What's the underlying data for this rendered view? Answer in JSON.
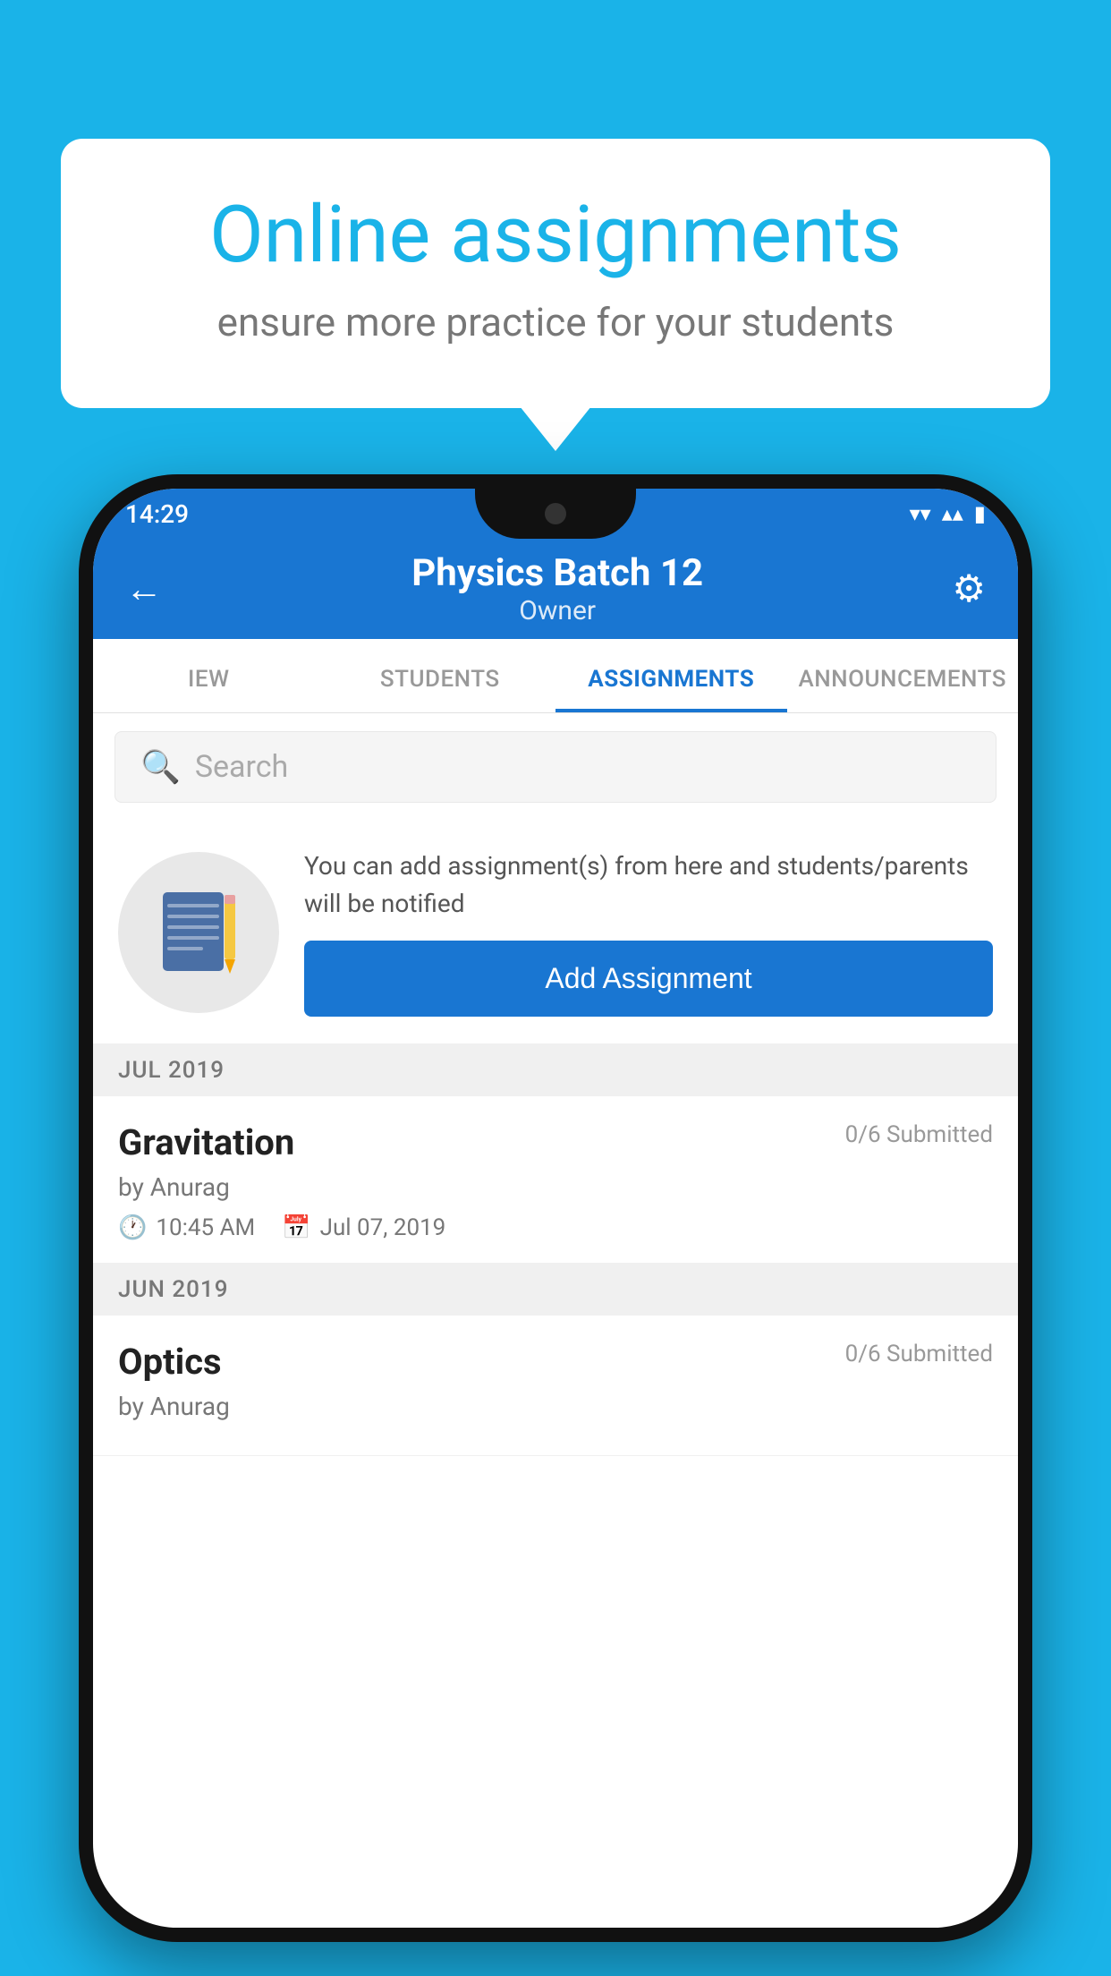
{
  "background": {
    "color": "#1ab3e8"
  },
  "speech_bubble": {
    "title": "Online assignments",
    "subtitle": "ensure more practice for your students"
  },
  "phone": {
    "status_bar": {
      "time": "14:29",
      "wifi_icon": "▼",
      "signal_icon": "▲",
      "battery_icon": "▮"
    },
    "header": {
      "title": "Physics Batch 12",
      "subtitle": "Owner",
      "back_label": "←",
      "settings_label": "⚙"
    },
    "tabs": [
      {
        "id": "view",
        "label": "IEW",
        "active": false
      },
      {
        "id": "students",
        "label": "STUDENTS",
        "active": false
      },
      {
        "id": "assignments",
        "label": "ASSIGNMENTS",
        "active": true
      },
      {
        "id": "announcements",
        "label": "ANNOUNCEMENTS",
        "active": false
      }
    ],
    "search": {
      "placeholder": "Search"
    },
    "promo": {
      "description": "You can add assignment(s) from here and students/parents will be notified",
      "button_label": "Add Assignment"
    },
    "sections": [
      {
        "id": "jul-2019",
        "label": "JUL 2019",
        "assignments": [
          {
            "id": "gravitation",
            "title": "Gravitation",
            "submitted": "0/6 Submitted",
            "author": "by Anurag",
            "time": "10:45 AM",
            "date": "Jul 07, 2019"
          }
        ]
      },
      {
        "id": "jun-2019",
        "label": "JUN 2019",
        "assignments": [
          {
            "id": "optics",
            "title": "Optics",
            "submitted": "0/6 Submitted",
            "author": "by Anurag",
            "time": "",
            "date": ""
          }
        ]
      }
    ]
  }
}
